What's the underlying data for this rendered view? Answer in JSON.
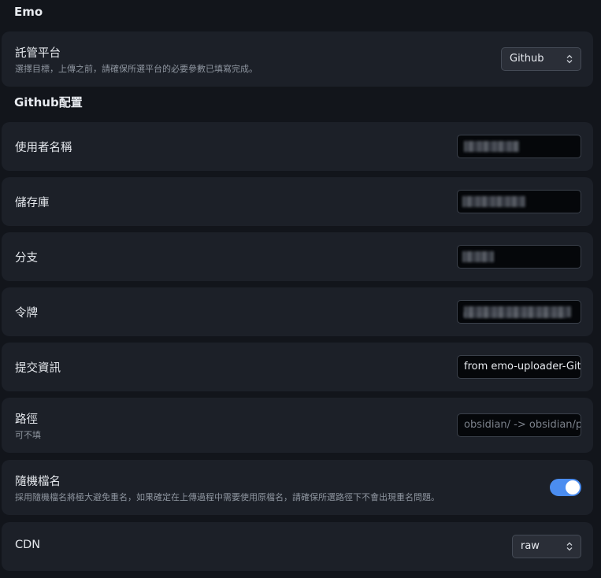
{
  "headings": {
    "emo": "Emo",
    "github_config": "Github配置"
  },
  "hosting": {
    "name": "託管平台",
    "desc": "選擇目標，上傳之前，請確保所選平台的必要參數已填寫完成。",
    "selected": "Github"
  },
  "username": {
    "name": "使用者名稱"
  },
  "repository": {
    "name": "儲存庫"
  },
  "branch": {
    "name": "分支"
  },
  "token": {
    "name": "令牌"
  },
  "commit": {
    "name": "提交資訊",
    "value": "from emo-uploader-Git"
  },
  "path": {
    "name": "路徑",
    "desc": "可不填",
    "placeholder": "obsidian/ -> obsidian/p"
  },
  "random_filename": {
    "name": "隨機檔名",
    "desc": "採用隨機檔名將極大避免重名，如果確定在上傳過程中需要使用原檔名，請確保所選路徑下不會出現重名問題。",
    "enabled": true
  },
  "cdn": {
    "name": "CDN",
    "selected": "raw"
  },
  "colors": {
    "accent": "#4b8df0",
    "background": "#12151b",
    "row": "#1c2028"
  }
}
